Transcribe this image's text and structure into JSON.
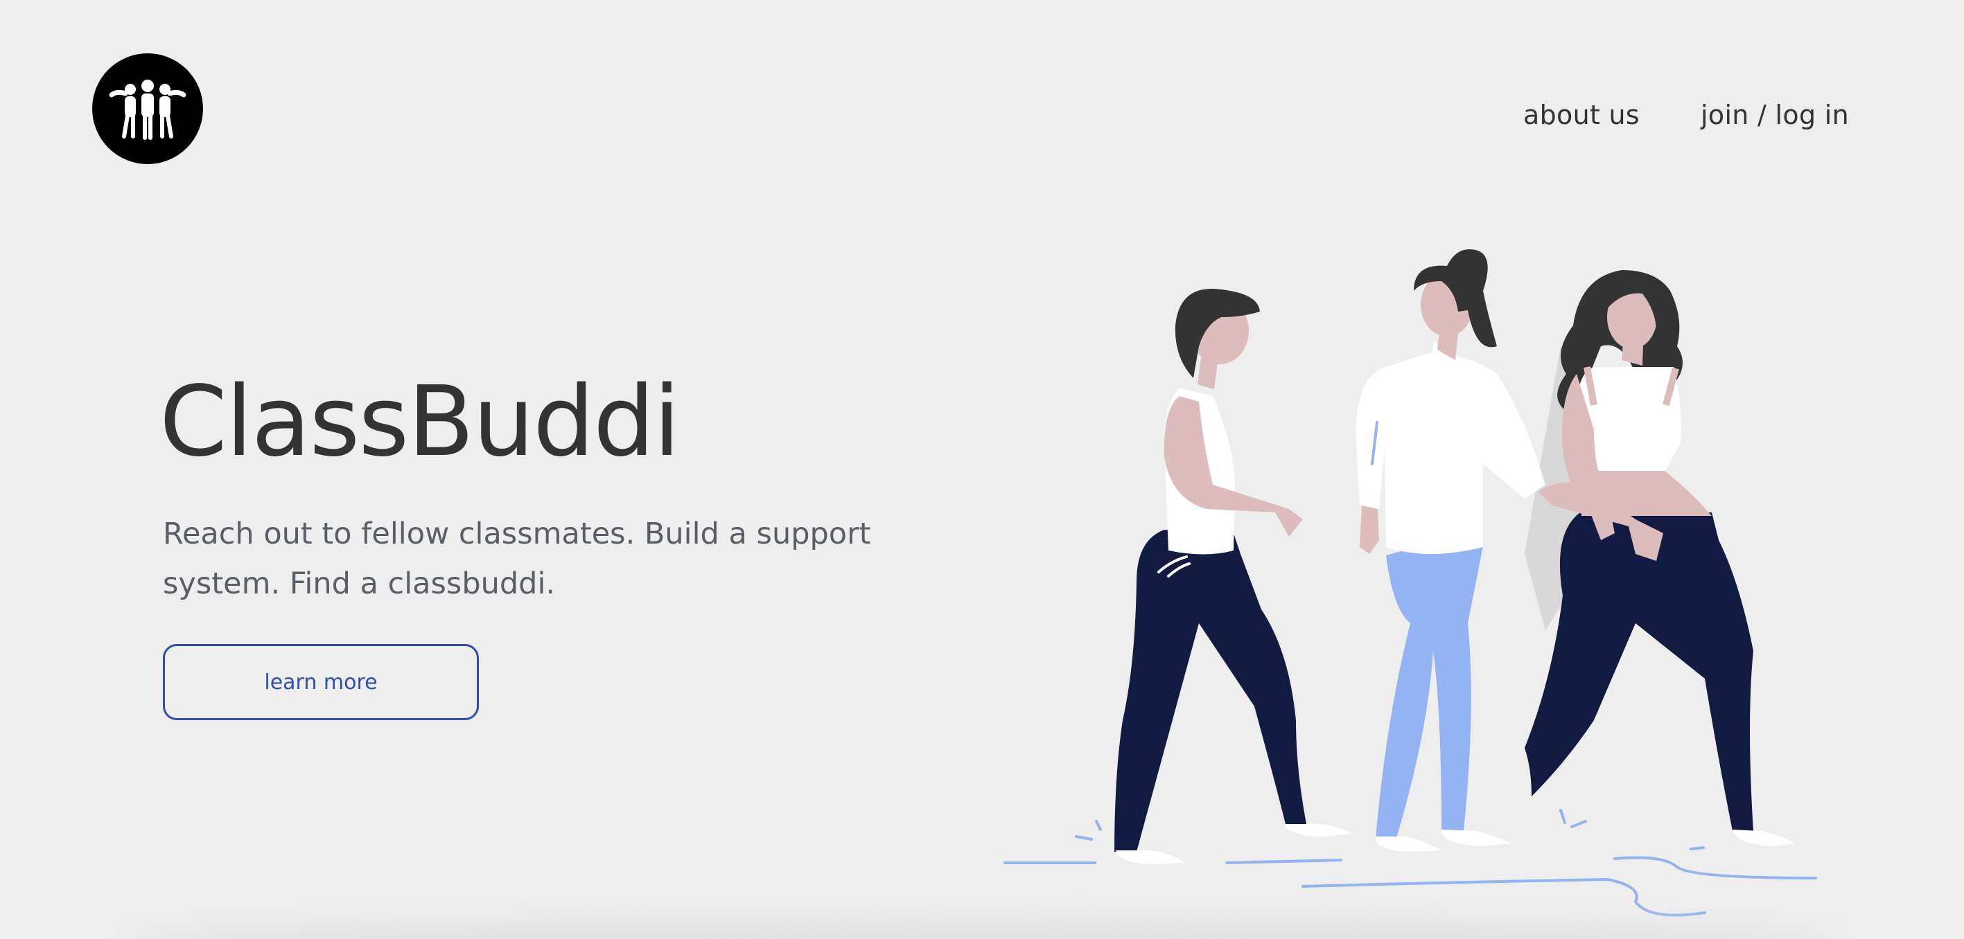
{
  "brand": {
    "logo_icon": "group-of-people-icon"
  },
  "nav": {
    "about_label": "about us",
    "join_label": "join / log in"
  },
  "hero": {
    "title": "ClassBuddi",
    "subtitle": "Reach out to fellow classmates. Build a support system. Find a classbuddi.",
    "cta_label": "learn more",
    "illustration": "three-people-walking-illustration"
  },
  "colors": {
    "background": "#eeeeef",
    "text_dark": "#333333",
    "text_muted": "#5a5e66",
    "accent_blue": "#2c4fb0",
    "navy": "#121c42",
    "light_blue": "#93b3f2",
    "skin": "#dcbcbc",
    "hair": "#333333"
  }
}
